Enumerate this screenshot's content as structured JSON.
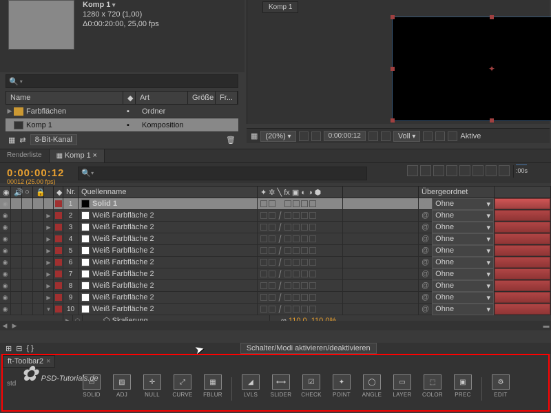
{
  "comp": {
    "name": "Komp 1",
    "dims": "1280 x 720 (1,00)",
    "dur": "Δ0:00:20:00, 25,00 fps"
  },
  "project": {
    "head": {
      "name": "Name",
      "art": "Art",
      "size": "Größe",
      "fr": "Fr..."
    },
    "rows": [
      {
        "name": "Farbflächen",
        "art": "Ordner",
        "folder": true
      },
      {
        "name": "Komp 1",
        "art": "Komposition",
        "folder": false,
        "sel": true
      }
    ],
    "footer": {
      "bpc": "8-Bit-Kanal"
    }
  },
  "viewer": {
    "tab": "Komp 1",
    "footer": {
      "zoom": "(20%)",
      "time": "0:00:00:12",
      "res": "Voll",
      "aktive": "Aktive"
    }
  },
  "timeline": {
    "tabs": {
      "render": "Renderliste",
      "comp": "Komp 1"
    },
    "timecode": "0:00:00:12",
    "fps": "00012 (25.00 fps)",
    "ruler": ":00s",
    "head": {
      "nr": "Nr.",
      "source": "Quellenname",
      "parent": "Übergeordnet"
    },
    "layers": [
      {
        "n": "1",
        "name": "Solid 1",
        "black": true,
        "sel": true
      },
      {
        "n": "2",
        "name": "Weiß Farbfläche 2"
      },
      {
        "n": "3",
        "name": "Weiß Farbfläche 2"
      },
      {
        "n": "4",
        "name": "Weiß Farbfläche 2"
      },
      {
        "n": "5",
        "name": "Weiß Farbfläche 2"
      },
      {
        "n": "6",
        "name": "Weiß Farbfläche 2"
      },
      {
        "n": "7",
        "name": "Weiß Farbfläche 2"
      },
      {
        "n": "8",
        "name": "Weiß Farbfläche 2"
      },
      {
        "n": "9",
        "name": "Weiß Farbfläche 2"
      },
      {
        "n": "10",
        "name": "Weiß Farbfläche 2",
        "open": true
      }
    ],
    "prop": {
      "name": "Skalierung",
      "value": "110,0, 110,0%"
    },
    "parent_none": "Ohne",
    "toggle": "Schalter/Modi aktivieren/deaktivieren"
  },
  "toolbar": {
    "tab": "ft-Toolbar2",
    "std": "std",
    "buttons": [
      {
        "l": "SOLID",
        "i": "▭"
      },
      {
        "l": "ADJ",
        "i": "▨"
      },
      {
        "l": "NULL",
        "i": "✛"
      },
      {
        "l": "CURVE",
        "i": "⤢"
      },
      {
        "l": "FBLUR",
        "i": "▦"
      },
      {
        "l": "LVLS",
        "i": "◢"
      },
      {
        "l": "SLIDER",
        "i": "⟷"
      },
      {
        "l": "CHECK",
        "i": "☑"
      },
      {
        "l": "POINT",
        "i": "✦"
      },
      {
        "l": "ANGLE",
        "i": "◯"
      },
      {
        "l": "LAYER",
        "i": "▭"
      },
      {
        "l": "COLOR",
        "i": "⬚"
      },
      {
        "l": "PREC",
        "i": "▣"
      },
      {
        "l": "EDIT",
        "i": "⚙"
      }
    ]
  },
  "watermark": "PSD-Tutorials.de"
}
